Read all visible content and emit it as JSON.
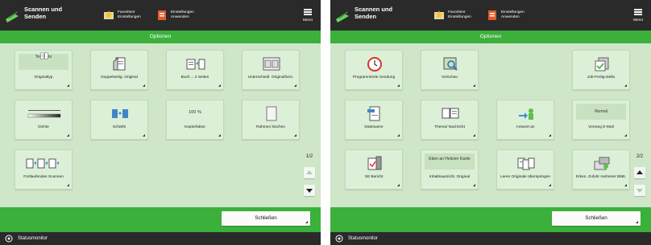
{
  "colors": {
    "accent_green": "#3bb03b",
    "header_dark": "#2a2a2a",
    "panel_bg": "#cfe6c9",
    "tile_bg": "#dcefd7"
  },
  "header": {
    "title": "Scannen und Senden",
    "favorites": "Favoritenr Einstellungen",
    "defaults": "Einstellungen Anwenden",
    "menu": "Menü"
  },
  "titlebar": "Optionen",
  "left": {
    "page": "1/2",
    "tiles": [
      {
        "value": "Text/Foto",
        "label": "Originaltyp",
        "icon": "document-type-icon"
      },
      {
        "label": "Doppelseitig. Original",
        "icon": "duplex-original-icon"
      },
      {
        "label": "Buch→ 2 Seiten",
        "icon": "book-to-pages-icon"
      },
      {
        "label": "Unterschiedl. Originalform.",
        "icon": "mixed-sizes-icon"
      },
      {
        "label": "Dichte",
        "icon": "density-slider-icon"
      },
      {
        "label": "Schärfe",
        "icon": "sharpness-icon"
      },
      {
        "value": "100 %",
        "label": "Kopierfaktor",
        "icon": ""
      },
      {
        "label": "Rahmen löschen",
        "icon": "erase-frame-icon"
      },
      {
        "label": "Fortlaufendes Scannen",
        "icon": "continuous-scan-icon"
      }
    ],
    "close": "Schließen"
  },
  "right": {
    "page": "2/2",
    "tiles": [
      {
        "label": "Programmierte Sendung",
        "icon": "timer-icon"
      },
      {
        "label": "Vorschau",
        "icon": "preview-icon"
      },
      {
        "label": "Job-Fertig-stellu",
        "icon": "job-done-icon"
      },
      {
        "label": "Dateiname",
        "icon": "file-name-icon"
      },
      {
        "label": "Thema/ Nachricht",
        "icon": "subject-message-icon"
      },
      {
        "label": "Antwort an",
        "icon": "reply-to-icon"
      },
      {
        "value": "Normal",
        "label": "Vorrang E-Mail",
        "icon": ""
      },
      {
        "label": "SE Bericht",
        "icon": "report-icon"
      },
      {
        "value": "Eben an Heitzen Kante",
        "label": "Inhaltsausricht. Original",
        "icon": ""
      },
      {
        "label": "Leere Originale überspringen",
        "icon": "skip-blank-icon"
      },
      {
        "label": "Erken. Zufuhr mehrerer Blätt.",
        "icon": "multi-feed-icon"
      }
    ],
    "close": "Schließen"
  },
  "status": "Statusmonitor"
}
